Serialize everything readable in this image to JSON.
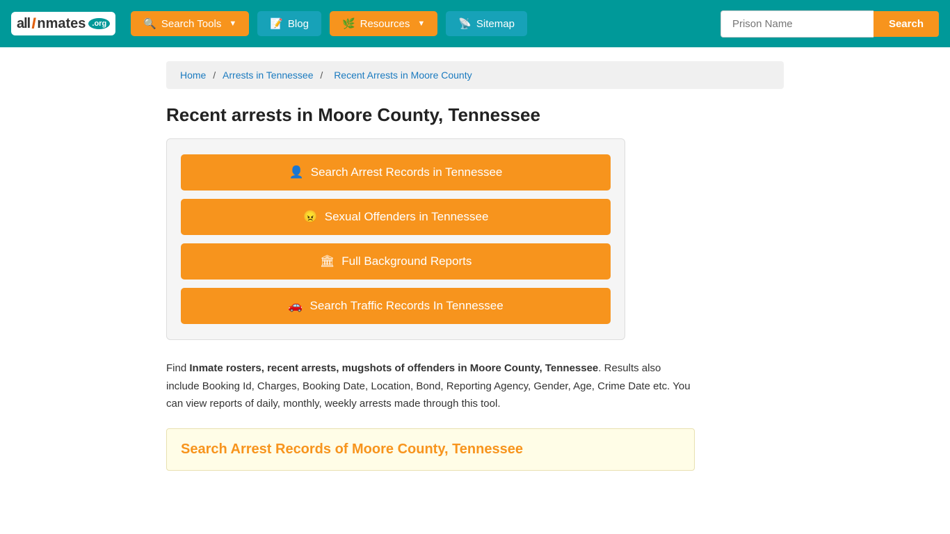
{
  "navbar": {
    "logo": {
      "all": "all",
      "in": "I",
      "mates": "nmates",
      "org": ".org"
    },
    "search_tools_label": "Search Tools",
    "blog_label": "Blog",
    "resources_label": "Resources",
    "sitemap_label": "Sitemap",
    "search_input_placeholder": "Prison Name",
    "search_button_label": "Search"
  },
  "breadcrumb": {
    "home": "Home",
    "arrests_in_tn": "Arrests in Tennessee",
    "current": "Recent Arrests in Moore County"
  },
  "page": {
    "title": "Recent arrests in Moore County, Tennessee",
    "buttons": [
      {
        "label": "Search Arrest Records in Tennessee",
        "icon": "👤"
      },
      {
        "label": "Sexual Offenders in Tennessee",
        "icon": "😠"
      },
      {
        "label": "Full Background Reports",
        "icon": "🏛"
      },
      {
        "label": "Search Traffic Records In Tennessee",
        "icon": "🚗"
      }
    ],
    "description_intro": "Find ",
    "description_bold": "Inmate rosters, recent arrests, mugshots of offenders in Moore County, Tennessee",
    "description_rest": ". Results also include Booking Id, Charges, Booking Date, Location, Bond, Reporting Agency, Gender, Age, Crime Date etc. You can view reports of daily, monthly, weekly arrests made through this tool.",
    "section_title": "Search Arrest Records of Moore County, Tennessee"
  }
}
